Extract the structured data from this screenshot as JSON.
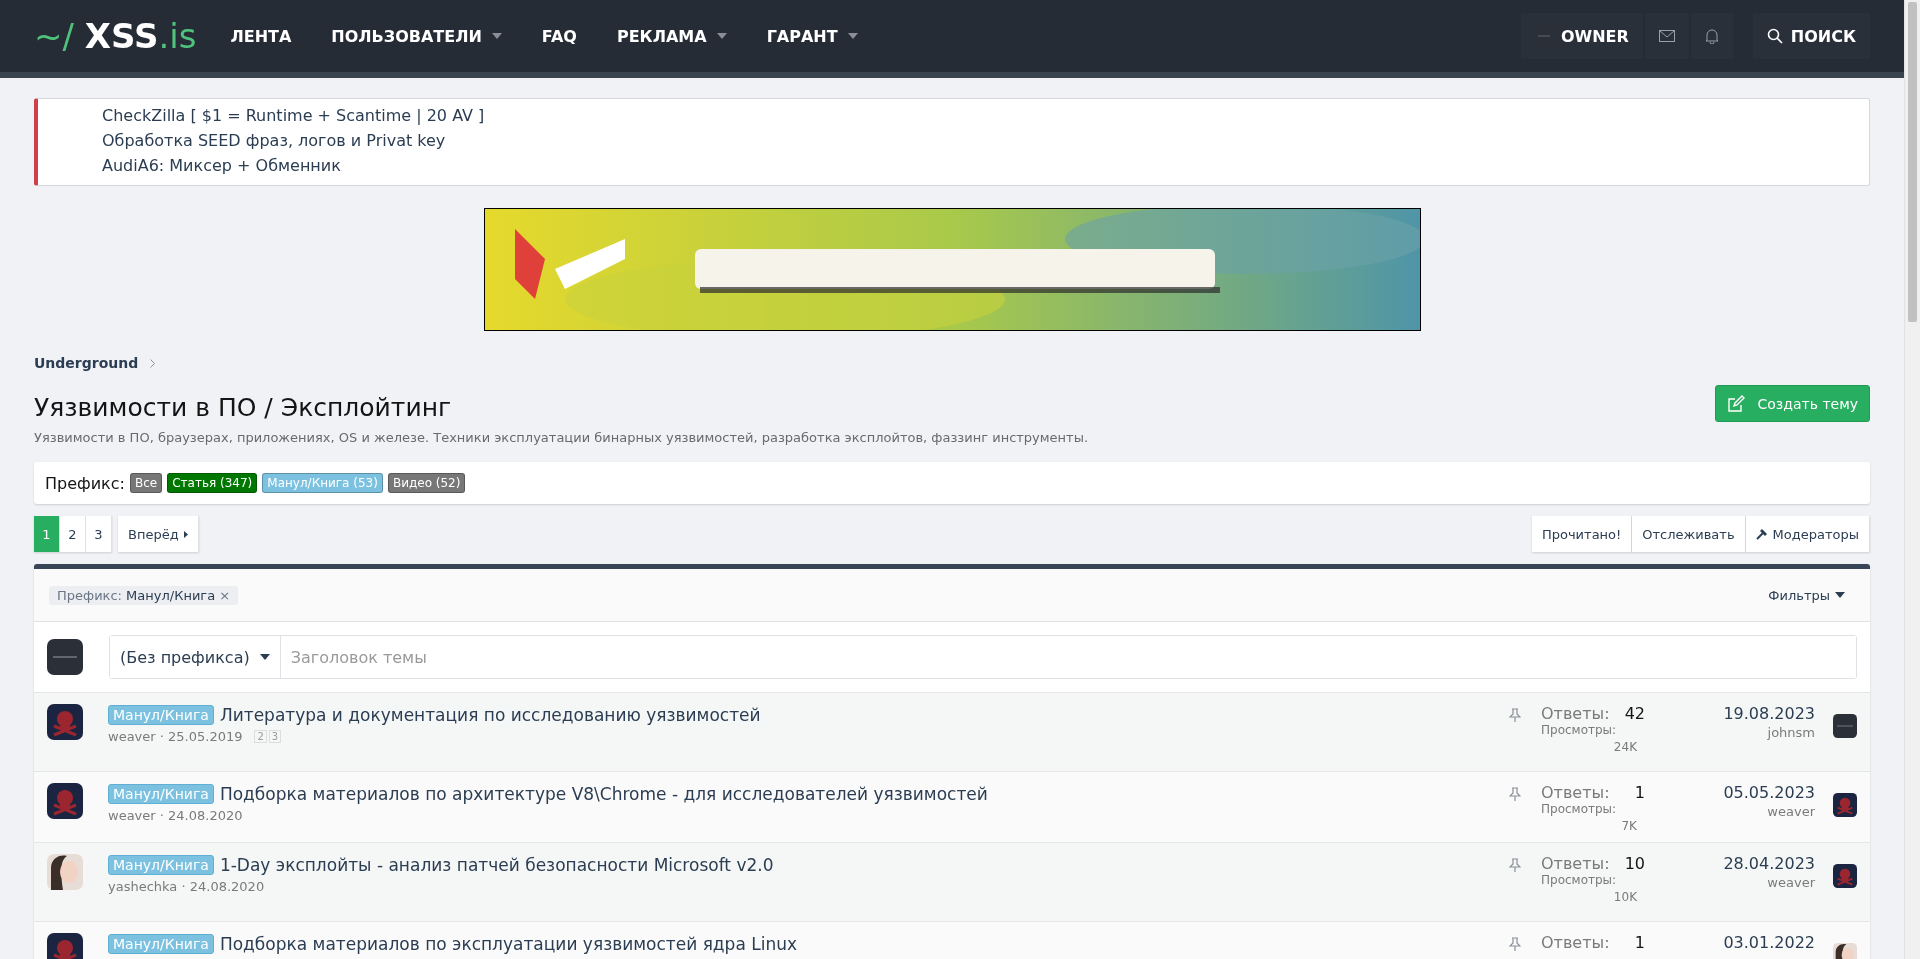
{
  "header": {
    "logo": {
      "prefix": "~/",
      "name": "XSS",
      "suffix": ".is"
    },
    "nav": [
      {
        "label": "ЛЕНТА",
        "dropdown": false
      },
      {
        "label": "ПОЛЬЗОВАТЕЛИ",
        "dropdown": true
      },
      {
        "label": "FAQ",
        "dropdown": false
      },
      {
        "label": "РЕКЛАМА",
        "dropdown": true
      },
      {
        "label": "ГАРАНТ",
        "dropdown": true
      }
    ],
    "user": "OWNER",
    "search": "ПОИСК"
  },
  "notice": {
    "lines": [
      "CheckZilla [ $1 = Runtime + Scantime | 20 AV ]",
      "Обработка SEED фраз, логов и Privat key",
      "AudiA6: Миксер + Обменник"
    ]
  },
  "banner": {
    "kind": "picture"
  },
  "breadcrumb": [
    "Underground"
  ],
  "forum": {
    "title": "Уязвимости в ПО / Эксплойтинг",
    "description": "Уязвимости в ПО, браузерах, приложениях, OS и железе. Техники эксплуатации бинарных уязвимостей, разработка эксплойтов, фаззинг инструменты.",
    "create_button": "Создать тему"
  },
  "prefix_filter": {
    "label": "Префикс:",
    "tags": [
      {
        "label": "Все",
        "color": "#777777"
      },
      {
        "label": "Статья (347)",
        "color": "#007700"
      },
      {
        "label": "Манул/Книга (53)",
        "color": "#7cc2e0"
      },
      {
        "label": "Видео (52)",
        "color": "#777777"
      }
    ]
  },
  "pagination": {
    "pages": [
      {
        "label": "1",
        "selected": true
      },
      {
        "label": "2",
        "selected": false
      },
      {
        "label": "3",
        "selected": false
      }
    ],
    "next": "Вперёд"
  },
  "actions": [
    {
      "label": "Прочитано!",
      "kind": "plain"
    },
    {
      "label": "Отслеживать",
      "kind": "plain"
    },
    {
      "label": "Модераторы",
      "kind": "tool"
    }
  ],
  "list": {
    "active_filter": {
      "label": "Префикс:",
      "value": "Манул/Книга",
      "remove": "×"
    },
    "filters": "Фильтры",
    "new_thread": {
      "prefix": "(Без префикса)",
      "placeholder": "Заголовок темы"
    },
    "threads": [
      {
        "prefix": "Манул/Книга",
        "title": "Литература и документация по исследованию уязвимостей",
        "meta": "weaver · 25.05.2019",
        "pages": [
          "2",
          "3"
        ],
        "avatar": {
          "kind": "skull"
        },
        "replies_label": "Ответы:",
        "replies": "42",
        "views_label": "Просмотры:",
        "views": "24K",
        "last_date": "19.08.2023",
        "last_user": "johnsm",
        "last_avatar": {
          "kind": "dark"
        }
      },
      {
        "prefix": "Манул/Книга",
        "title": "Подборка материалов по архитектуре V8\\Chrome - для исследователей уязвимостей",
        "meta": "weaver · 24.08.2020",
        "avatar": {
          "kind": "skull"
        },
        "replies_label": "Ответы:",
        "replies": "1",
        "views_label": "Просмотры:",
        "views": "7K",
        "last_date": "05.05.2023",
        "last_user": "weaver",
        "last_avatar": {
          "kind": "skull"
        }
      },
      {
        "prefix": "Манул/Книга",
        "title": "1-Day эксплойты - анализ патчей безопасности Microsoft v2.0",
        "meta": "yashechka · 24.08.2020",
        "avatar": {
          "kind": "person"
        },
        "replies_label": "Ответы:",
        "replies": "10",
        "views_label": "Просмотры:",
        "views": "10K",
        "last_date": "28.04.2023",
        "last_user": "weaver",
        "last_avatar": {
          "kind": "skull"
        }
      },
      {
        "prefix": "Манул/Книга",
        "title": "Подборка материалов по эксплуатации уязвимостей ядра Linux",
        "avatar": {
          "kind": "skull"
        },
        "replies_label": "Ответы:",
        "replies": "1",
        "last_date": "03.01.2022",
        "last_avatar": {
          "kind": "person"
        }
      }
    ]
  }
}
